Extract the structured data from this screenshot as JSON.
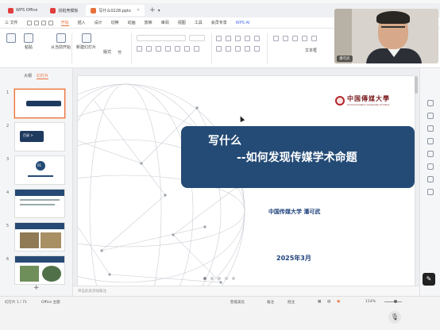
{
  "tabs": [
    {
      "label": "WPS Office",
      "color": "#e23d3d"
    },
    {
      "label": "找稻壳模板",
      "color": "#e23d3d"
    },
    {
      "label": "写什么0228.pptx",
      "color": "#e8703a"
    }
  ],
  "menu": {
    "file": "三 文件",
    "items": [
      "开始",
      "插入",
      "设计",
      "切换",
      "动画",
      "放映",
      "审阅",
      "视图",
      "工具",
      "会员专享"
    ],
    "ai": "WPS AI"
  },
  "ribbon": {
    "paste": "粘贴",
    "from_start": "从当前开始",
    "new_slide": "新建幻灯片",
    "layout": "版式",
    "section": "节",
    "textbox": "文本框",
    "arrange": "排列",
    "picture": "图片"
  },
  "left_panel": {
    "tab_outline": "大纲",
    "tab_slides": "幻灯片",
    "slide_numbers": [
      "1",
      "2",
      "3",
      "4",
      "5",
      "6"
    ],
    "thumb2_title": "目录 >",
    "thumb3_title": "01"
  },
  "slide": {
    "logo_cn": "中国傳媒大學",
    "logo_en": "Communication University of China",
    "title_line1": "写什么",
    "title_line2": "--如何发现传媒学术命题",
    "author": "中国传媒大学   潘可武",
    "date": "2025年3月"
  },
  "notes_placeholder": "单击此处添加备注",
  "status": {
    "slide_count": "幻灯片 1 / 71",
    "theme": "Office 主题",
    "smart_beautify": "智能美化",
    "notes": "备注",
    "comments": "批注",
    "zoom": "114%"
  },
  "webcam": {
    "name": "潘可武"
  }
}
